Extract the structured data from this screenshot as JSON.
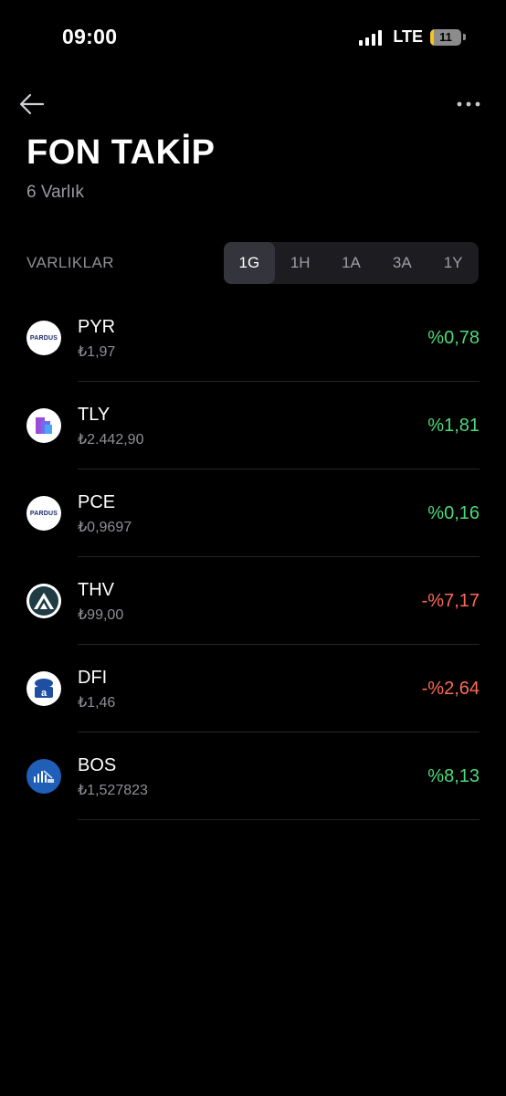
{
  "status_bar": {
    "time": "09:00",
    "network": "LTE",
    "battery_level": "11",
    "battery_fraction": 0.11,
    "signal_bars": 4
  },
  "header": {
    "back_icon": "arrow-left-icon",
    "more_icon": "ellipsis-horizontal-icon",
    "title": "FON TAKİP",
    "subtitle": "6 Varlık"
  },
  "section": {
    "label": "VARLIKLAR",
    "periods": [
      "1G",
      "1H",
      "1A",
      "3A",
      "1Y"
    ],
    "active_period": "1G"
  },
  "colors": {
    "background": "#000000",
    "positive": "#4cd97b",
    "negative": "#ff6b55",
    "muted_text": "#8e8e96",
    "tab_bg": "#1c1c21",
    "tab_active_bg": "#34343c"
  },
  "assets": [
    {
      "symbol": "PYR",
      "price": "₺1,97",
      "change": "%0,78",
      "direction": "up",
      "logo": "pardus-logo",
      "logo_text": "PARDUS"
    },
    {
      "symbol": "TLY",
      "price": "₺2.442,90",
      "change": "%1,81",
      "direction": "up",
      "logo": "tly-purple-cube-logo"
    },
    {
      "symbol": "PCE",
      "price": "₺0,9697",
      "change": "%0,16",
      "direction": "up",
      "logo": "pardus-logo",
      "logo_text": "PARDUS"
    },
    {
      "symbol": "THV",
      "price": "₺99,00",
      "change": "-%7,17",
      "direction": "down",
      "logo": "thv-mountain-logo"
    },
    {
      "symbol": "DFI",
      "price": "₺1,46",
      "change": "-%2,64",
      "direction": "down",
      "logo": "dfi-blue-logo"
    },
    {
      "symbol": "BOS",
      "price": "₺1,527823",
      "change": "%8,13",
      "direction": "up",
      "logo": "bos-blue-logo"
    }
  ]
}
